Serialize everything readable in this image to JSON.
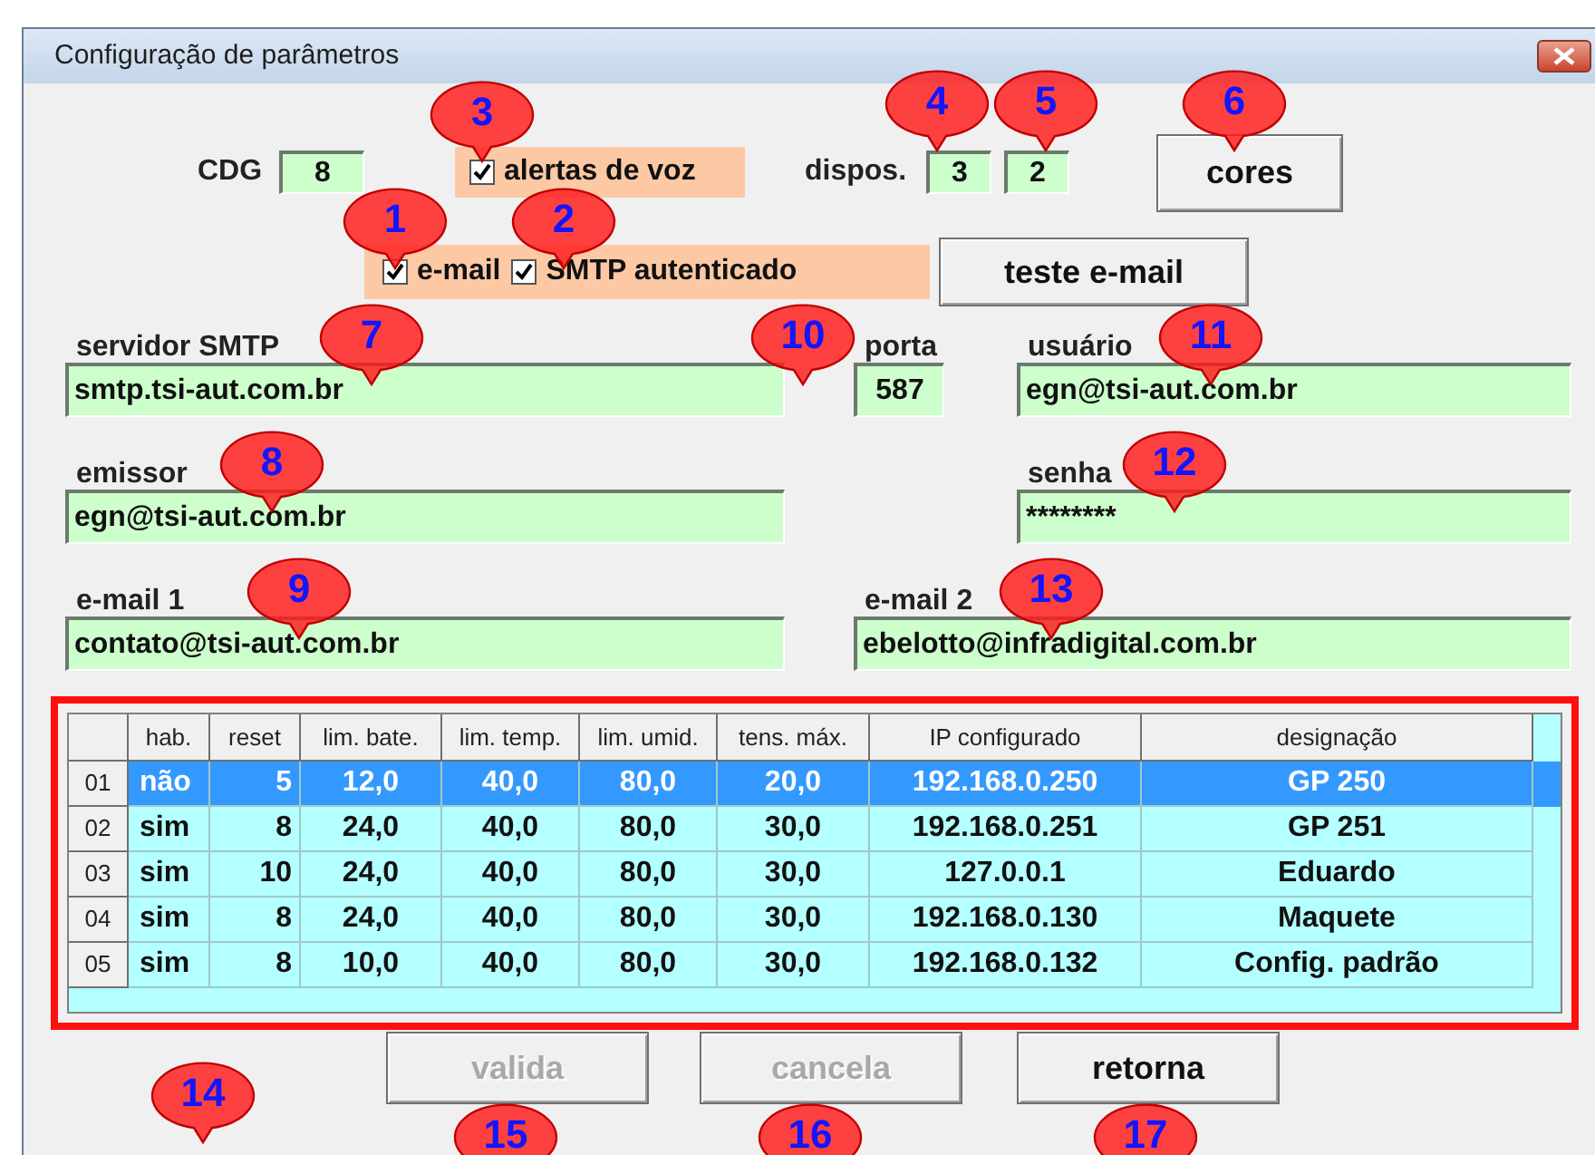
{
  "window": {
    "title": "Configuração de parâmetros"
  },
  "top_row": {
    "cdg": {
      "label": "CDG",
      "value": "8"
    },
    "voice_alerts": {
      "label": "alertas de voz",
      "checked": true
    },
    "devices": {
      "label": "dispos.",
      "values": [
        "3",
        "2"
      ]
    },
    "colors_button": {
      "label": "cores"
    }
  },
  "email_row": {
    "email": {
      "label": "e-mail",
      "checked": true
    },
    "smtp_auth": {
      "label": "SMTP autenticado",
      "checked": true
    },
    "test_button": {
      "label": "teste e-mail"
    }
  },
  "fields": {
    "smtp_server": {
      "label": "servidor SMTP",
      "value": "smtp.tsi-aut.com.br"
    },
    "port": {
      "label": "porta",
      "value": "587"
    },
    "user": {
      "label": "usuário",
      "value": "egn@tsi-aut.com.br"
    },
    "sender": {
      "label": "emissor",
      "value": "egn@tsi-aut.com.br"
    },
    "password": {
      "label": "senha",
      "value": "********"
    },
    "email_1": {
      "label": "e-mail 1",
      "value": "contato@tsi-aut.com.br"
    },
    "email_2": {
      "label": "e-mail 2",
      "value": "ebelotto@infradigital.com.br"
    }
  },
  "table": {
    "columns": [
      "hab.",
      "reset",
      "lim. bate.",
      "lim. temp.",
      "lim. umid.",
      "tens. máx.",
      "IP configurado",
      "designação"
    ],
    "rows": [
      {
        "number": "01",
        "selected": true,
        "cells": [
          "não",
          "5",
          "12,0",
          "40,0",
          "80,0",
          "20,0",
          "192.168.0.250",
          "GP 250"
        ]
      },
      {
        "number": "02",
        "selected": false,
        "cells": [
          "sim",
          "8",
          "24,0",
          "40,0",
          "80,0",
          "30,0",
          "192.168.0.251",
          "GP 251"
        ]
      },
      {
        "number": "03",
        "selected": false,
        "cells": [
          "sim",
          "10",
          "24,0",
          "40,0",
          "80,0",
          "30,0",
          "127.0.0.1",
          "Eduardo"
        ]
      },
      {
        "number": "04",
        "selected": false,
        "cells": [
          "sim",
          "8",
          "24,0",
          "40,0",
          "80,0",
          "30,0",
          "192.168.0.130",
          "Maquete"
        ]
      },
      {
        "number": "05",
        "selected": false,
        "cells": [
          "sim",
          "8",
          "10,0",
          "40,0",
          "80,0",
          "30,0",
          "192.168.0.132",
          "Config. padrão"
        ]
      }
    ]
  },
  "buttons": [
    {
      "label": "valida",
      "disabled": true
    },
    {
      "label": "cancela",
      "disabled": true
    },
    {
      "label": "retorna",
      "disabled": false
    }
  ],
  "callouts": [
    "1",
    "2",
    "3",
    "4",
    "5",
    "6",
    "7",
    "8",
    "9",
    "10",
    "11",
    "12",
    "13",
    "14",
    "15",
    "16",
    "17"
  ]
}
